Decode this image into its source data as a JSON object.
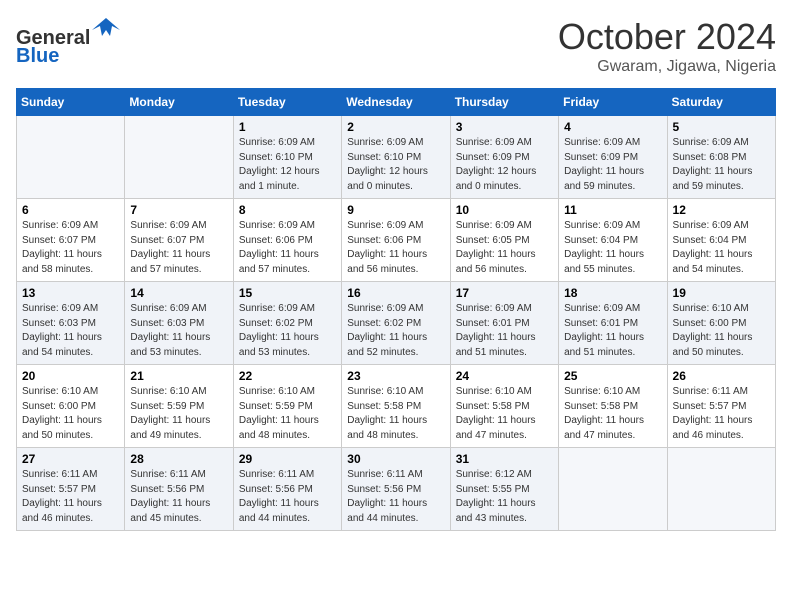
{
  "header": {
    "logo_line1": "General",
    "logo_line2": "Blue",
    "month": "October 2024",
    "location": "Gwaram, Jigawa, Nigeria"
  },
  "weekdays": [
    "Sunday",
    "Monday",
    "Tuesday",
    "Wednesday",
    "Thursday",
    "Friday",
    "Saturday"
  ],
  "weeks": [
    [
      {
        "day": "",
        "info": ""
      },
      {
        "day": "",
        "info": ""
      },
      {
        "day": "1",
        "info": "Sunrise: 6:09 AM\nSunset: 6:10 PM\nDaylight: 12 hours\nand 1 minute."
      },
      {
        "day": "2",
        "info": "Sunrise: 6:09 AM\nSunset: 6:10 PM\nDaylight: 12 hours\nand 0 minutes."
      },
      {
        "day": "3",
        "info": "Sunrise: 6:09 AM\nSunset: 6:09 PM\nDaylight: 12 hours\nand 0 minutes."
      },
      {
        "day": "4",
        "info": "Sunrise: 6:09 AM\nSunset: 6:09 PM\nDaylight: 11 hours\nand 59 minutes."
      },
      {
        "day": "5",
        "info": "Sunrise: 6:09 AM\nSunset: 6:08 PM\nDaylight: 11 hours\nand 59 minutes."
      }
    ],
    [
      {
        "day": "6",
        "info": "Sunrise: 6:09 AM\nSunset: 6:07 PM\nDaylight: 11 hours\nand 58 minutes."
      },
      {
        "day": "7",
        "info": "Sunrise: 6:09 AM\nSunset: 6:07 PM\nDaylight: 11 hours\nand 57 minutes."
      },
      {
        "day": "8",
        "info": "Sunrise: 6:09 AM\nSunset: 6:06 PM\nDaylight: 11 hours\nand 57 minutes."
      },
      {
        "day": "9",
        "info": "Sunrise: 6:09 AM\nSunset: 6:06 PM\nDaylight: 11 hours\nand 56 minutes."
      },
      {
        "day": "10",
        "info": "Sunrise: 6:09 AM\nSunset: 6:05 PM\nDaylight: 11 hours\nand 56 minutes."
      },
      {
        "day": "11",
        "info": "Sunrise: 6:09 AM\nSunset: 6:04 PM\nDaylight: 11 hours\nand 55 minutes."
      },
      {
        "day": "12",
        "info": "Sunrise: 6:09 AM\nSunset: 6:04 PM\nDaylight: 11 hours\nand 54 minutes."
      }
    ],
    [
      {
        "day": "13",
        "info": "Sunrise: 6:09 AM\nSunset: 6:03 PM\nDaylight: 11 hours\nand 54 minutes."
      },
      {
        "day": "14",
        "info": "Sunrise: 6:09 AM\nSunset: 6:03 PM\nDaylight: 11 hours\nand 53 minutes."
      },
      {
        "day": "15",
        "info": "Sunrise: 6:09 AM\nSunset: 6:02 PM\nDaylight: 11 hours\nand 53 minutes."
      },
      {
        "day": "16",
        "info": "Sunrise: 6:09 AM\nSunset: 6:02 PM\nDaylight: 11 hours\nand 52 minutes."
      },
      {
        "day": "17",
        "info": "Sunrise: 6:09 AM\nSunset: 6:01 PM\nDaylight: 11 hours\nand 51 minutes."
      },
      {
        "day": "18",
        "info": "Sunrise: 6:09 AM\nSunset: 6:01 PM\nDaylight: 11 hours\nand 51 minutes."
      },
      {
        "day": "19",
        "info": "Sunrise: 6:10 AM\nSunset: 6:00 PM\nDaylight: 11 hours\nand 50 minutes."
      }
    ],
    [
      {
        "day": "20",
        "info": "Sunrise: 6:10 AM\nSunset: 6:00 PM\nDaylight: 11 hours\nand 50 minutes."
      },
      {
        "day": "21",
        "info": "Sunrise: 6:10 AM\nSunset: 5:59 PM\nDaylight: 11 hours\nand 49 minutes."
      },
      {
        "day": "22",
        "info": "Sunrise: 6:10 AM\nSunset: 5:59 PM\nDaylight: 11 hours\nand 48 minutes."
      },
      {
        "day": "23",
        "info": "Sunrise: 6:10 AM\nSunset: 5:58 PM\nDaylight: 11 hours\nand 48 minutes."
      },
      {
        "day": "24",
        "info": "Sunrise: 6:10 AM\nSunset: 5:58 PM\nDaylight: 11 hours\nand 47 minutes."
      },
      {
        "day": "25",
        "info": "Sunrise: 6:10 AM\nSunset: 5:58 PM\nDaylight: 11 hours\nand 47 minutes."
      },
      {
        "day": "26",
        "info": "Sunrise: 6:11 AM\nSunset: 5:57 PM\nDaylight: 11 hours\nand 46 minutes."
      }
    ],
    [
      {
        "day": "27",
        "info": "Sunrise: 6:11 AM\nSunset: 5:57 PM\nDaylight: 11 hours\nand 46 minutes."
      },
      {
        "day": "28",
        "info": "Sunrise: 6:11 AM\nSunset: 5:56 PM\nDaylight: 11 hours\nand 45 minutes."
      },
      {
        "day": "29",
        "info": "Sunrise: 6:11 AM\nSunset: 5:56 PM\nDaylight: 11 hours\nand 44 minutes."
      },
      {
        "day": "30",
        "info": "Sunrise: 6:11 AM\nSunset: 5:56 PM\nDaylight: 11 hours\nand 44 minutes."
      },
      {
        "day": "31",
        "info": "Sunrise: 6:12 AM\nSunset: 5:55 PM\nDaylight: 11 hours\nand 43 minutes."
      },
      {
        "day": "",
        "info": ""
      },
      {
        "day": "",
        "info": ""
      }
    ]
  ]
}
